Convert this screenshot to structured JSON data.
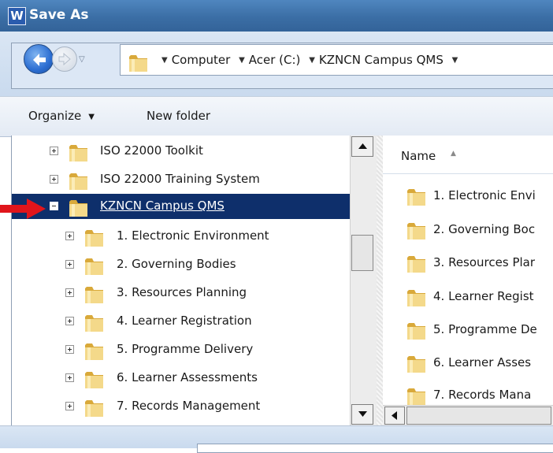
{
  "window": {
    "title": "Save As",
    "app_icon_letter": "W"
  },
  "navigation": {
    "breadcrumbs": [
      "Computer",
      "Acer (C:)",
      "KZNCN Campus QMS"
    ],
    "back_icon": "back-arrow-icon",
    "forward_icon": "forward-arrow-icon"
  },
  "toolbar": {
    "organize_label": "Organize",
    "new_folder_label": "New folder"
  },
  "tree": {
    "items": [
      {
        "label": "ISO 22000 Toolkit"
      },
      {
        "label": "ISO 22000 Training System"
      },
      {
        "label": "KZNCN Campus QMS"
      },
      {
        "label": "1. Electronic Environment"
      },
      {
        "label": "2. Governing Bodies"
      },
      {
        "label": "3. Resources Planning"
      },
      {
        "label": "4. Learner Registration"
      },
      {
        "label": "5. Programme Delivery"
      },
      {
        "label": "6. Learner Assessments"
      },
      {
        "label": "7. Records Management"
      }
    ]
  },
  "file_list": {
    "column_header": "Name",
    "items": [
      {
        "label": "1. Electronic Envi"
      },
      {
        "label": "2. Governing Boc"
      },
      {
        "label": "3. Resources Plar"
      },
      {
        "label": "4. Learner Regist"
      },
      {
        "label": "5. Programme De"
      },
      {
        "label": "6. Learner Asses"
      },
      {
        "label": "7. Records Mana"
      }
    ]
  },
  "colors": {
    "title_bar": "#3b6ea5",
    "selection": "#0e2f6b",
    "annotation_arrow": "#e0151b",
    "folder": "#e8c25a"
  }
}
